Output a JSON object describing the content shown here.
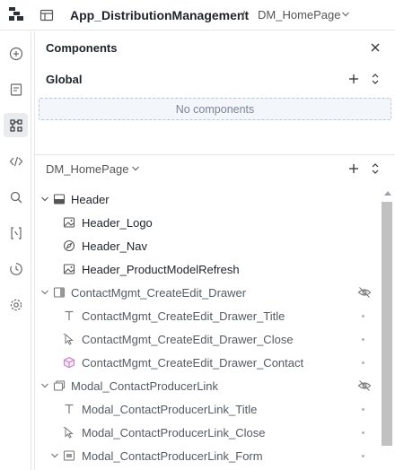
{
  "header": {
    "app_name": "App_DistributionManagement",
    "separator": "/",
    "page_name": "DM_HomePage"
  },
  "rail": {
    "items": [
      {
        "icon": "add-circle-icon"
      },
      {
        "icon": "document-icon"
      },
      {
        "icon": "components-tree-icon",
        "active": true
      },
      {
        "icon": "code-icon"
      },
      {
        "icon": "search-icon"
      },
      {
        "icon": "variables-icon"
      },
      {
        "icon": "history-icon"
      },
      {
        "icon": "settings-icon"
      }
    ]
  },
  "panel": {
    "title": "Components",
    "global": {
      "title": "Global",
      "empty_text": "No components"
    },
    "page_selector": "DM_HomePage",
    "tree": [
      {
        "label": "Header",
        "icon": "header-icon",
        "expanded": true
      },
      {
        "label": "Header_Logo",
        "icon": "image-icon"
      },
      {
        "label": "Header_Nav",
        "icon": "compass-icon"
      },
      {
        "label": "Header_ProductModelRefresh",
        "icon": "image-icon"
      },
      {
        "label": "ContactMgmt_CreateEdit_Drawer",
        "icon": "drawer-icon",
        "expanded": true,
        "hidden": true
      },
      {
        "label": "ContactMgmt_CreateEdit_Drawer_Title",
        "icon": "text-icon"
      },
      {
        "label": "ContactMgmt_CreateEdit_Drawer_Close",
        "icon": "pointer-icon"
      },
      {
        "label": "ContactMgmt_CreateEdit_Drawer_Contact",
        "icon": "cube-icon"
      },
      {
        "label": "Modal_ContactProducerLink",
        "icon": "modal-icon",
        "expanded": true,
        "hidden": true
      },
      {
        "label": "Modal_ContactProducerLink_Title",
        "icon": "text-icon"
      },
      {
        "label": "Modal_ContactProducerLink_Close",
        "icon": "pointer-icon"
      },
      {
        "label": "Modal_ContactProducerLink_Form",
        "icon": "form-icon",
        "expanded": true
      }
    ]
  }
}
